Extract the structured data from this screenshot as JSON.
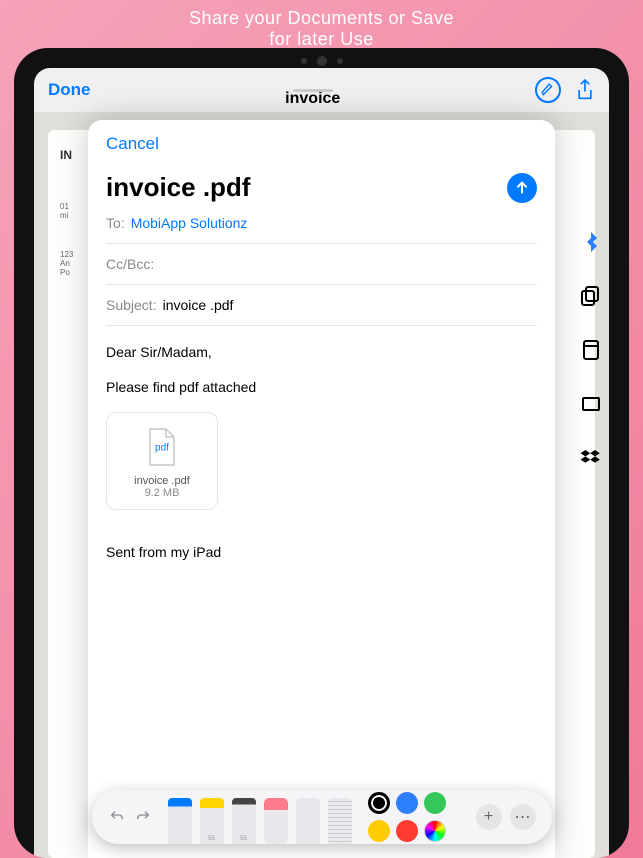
{
  "promo": {
    "line1": "Share your Documents or Save",
    "line2": "for later Use"
  },
  "nav": {
    "done": "Done",
    "title": "invoice"
  },
  "compose": {
    "cancel": "Cancel",
    "title": "invoice .pdf",
    "to_label": "To:",
    "to_value": "MobiApp Solutionz",
    "ccbcc_label": "Cc/Bcc:",
    "subject_label": "Subject:",
    "subject_value": "invoice .pdf",
    "body_greeting": "Dear Sir/Madam,",
    "body_text": "Please find pdf attached",
    "attachment": {
      "badge": "pdf",
      "name": "invoice .pdf",
      "size": "9.2 MB"
    },
    "signature": "Sent from my iPad"
  },
  "markup": {
    "tools": [
      "pen",
      "highlighter",
      "pencil",
      "eraser",
      "lasso",
      "ruler"
    ],
    "colors": [
      "black",
      "blue",
      "green",
      "yellow",
      "red",
      "wheel"
    ]
  },
  "bg_doc": {
    "heading": "IN",
    "line1": "01",
    "line2": "mi",
    "addr1": "123",
    "addr2": "An",
    "addr3": "Po"
  }
}
